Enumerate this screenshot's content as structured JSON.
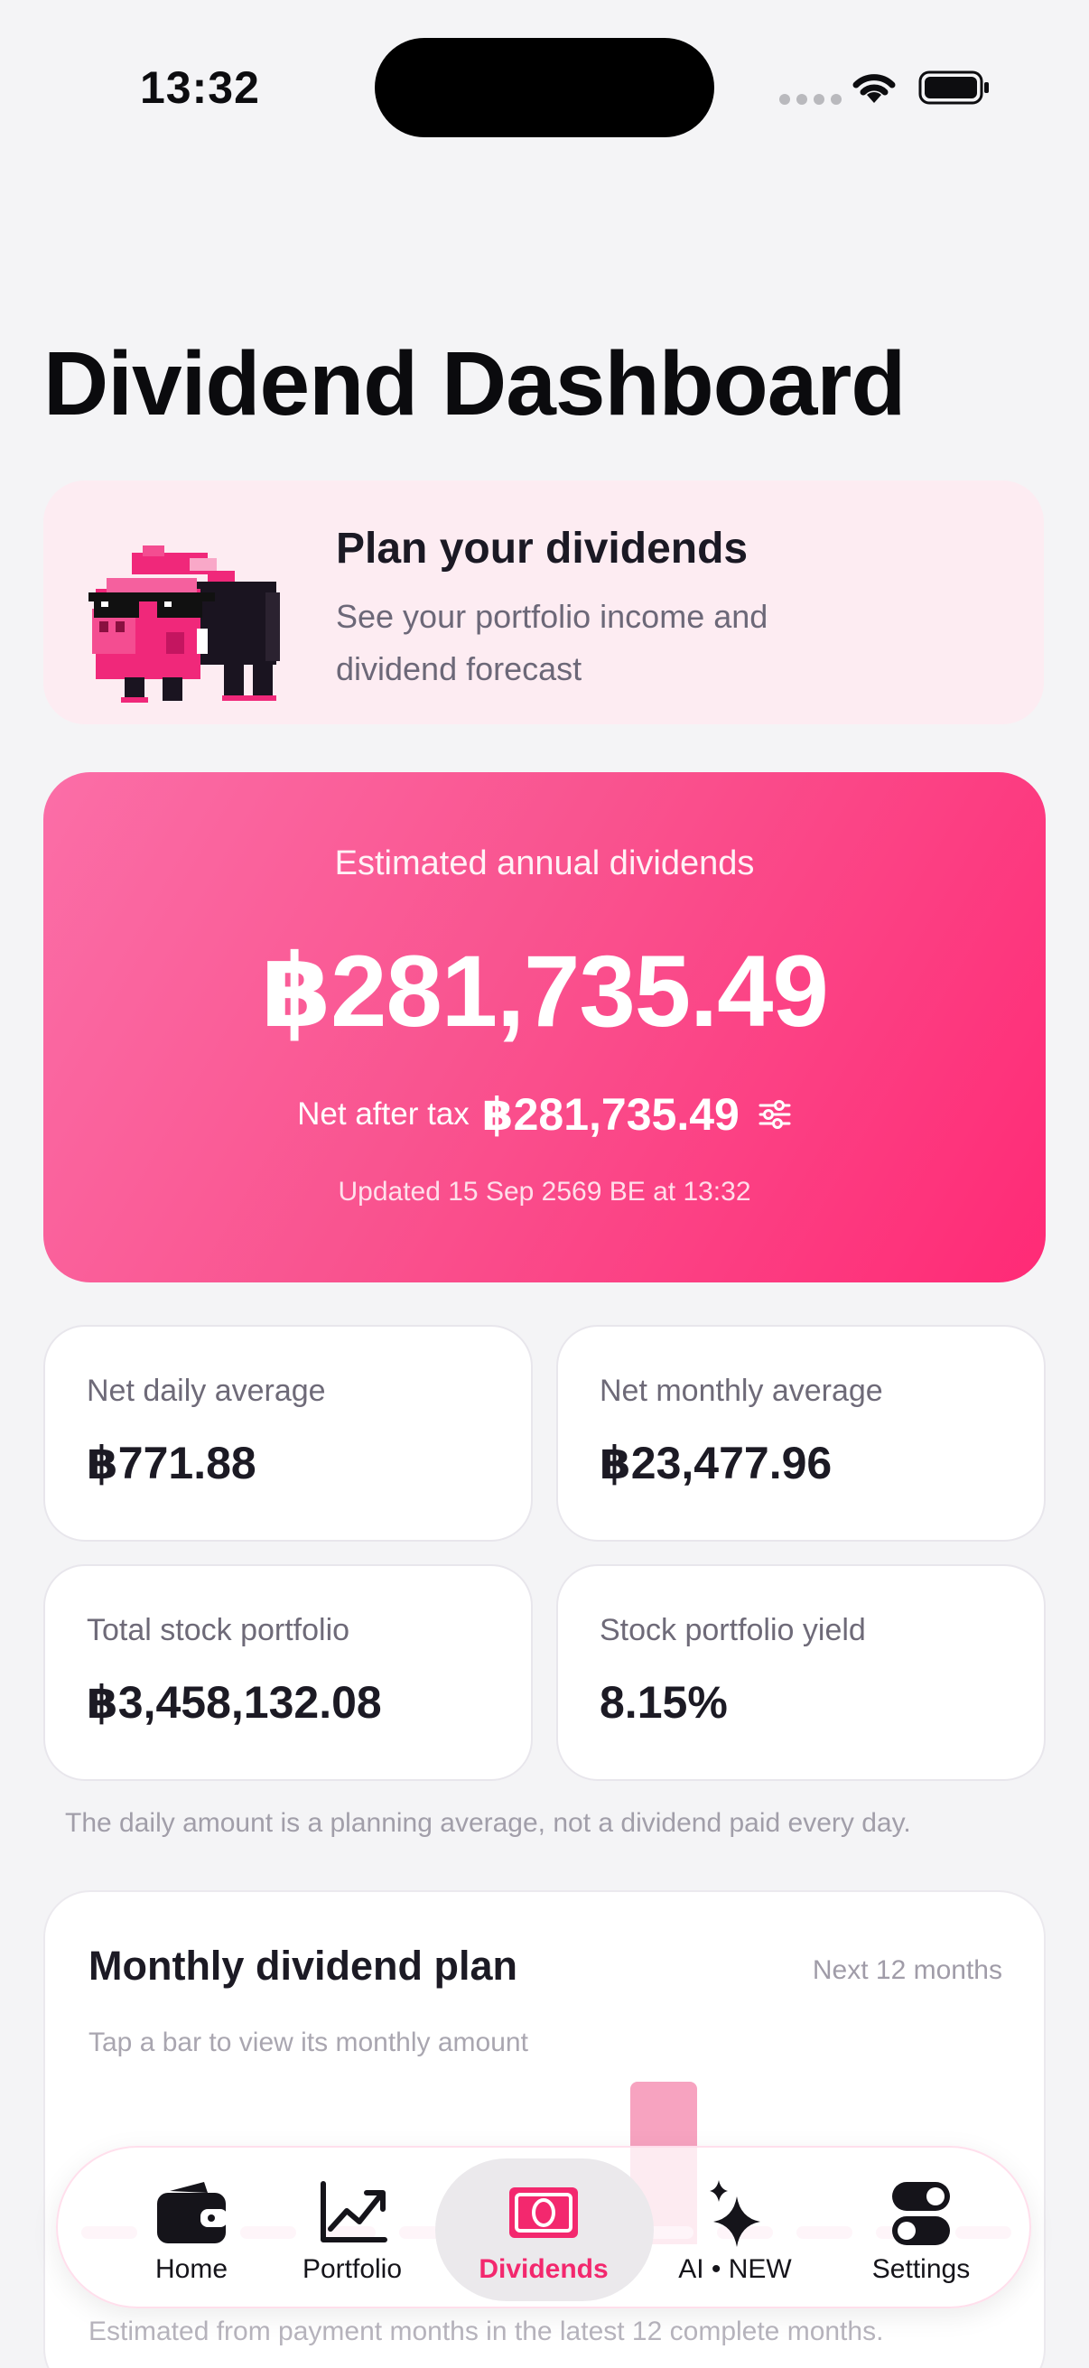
{
  "status": {
    "time": "13:32"
  },
  "page": {
    "title": "Dividend Dashboard"
  },
  "plan_card": {
    "title": "Plan your dividends",
    "subtitle": "See your portfolio income and dividend forecast"
  },
  "hero": {
    "label": "Estimated annual dividends",
    "amount": "฿281,735.49",
    "net_label": "Net after tax",
    "net_value": "฿281,735.49",
    "updated": "Updated 15 Sep 2569 BE at 13:32"
  },
  "stats": [
    {
      "label": "Net daily average",
      "value": "฿771.88"
    },
    {
      "label": "Net monthly average",
      "value": "฿23,477.96"
    },
    {
      "label": "Total stock portfolio",
      "value": "฿3,458,132.08"
    },
    {
      "label": "Stock portfolio yield",
      "value": "8.15%"
    }
  ],
  "note": "The daily amount is a planning average, not a dividend paid every day.",
  "monthly": {
    "title": "Monthly dividend plan",
    "range": "Next 12 months",
    "hint": "Tap a bar to view its monthly amount",
    "footer": "Estimated from payment months in the latest 12 complete months."
  },
  "tabs": [
    {
      "label": "Home",
      "icon": "wallet-icon"
    },
    {
      "label": "Portfolio",
      "icon": "chart-line-icon"
    },
    {
      "label": "Dividends",
      "icon": "banknote-icon",
      "active": true
    },
    {
      "label": "AI • NEW",
      "icon": "sparkles-icon"
    },
    {
      "label": "Settings",
      "icon": "toggles-icon"
    }
  ],
  "colors": {
    "accent": "#f3286e",
    "hero_start": "#fb6ea7",
    "hero_end": "#ff2a76"
  }
}
